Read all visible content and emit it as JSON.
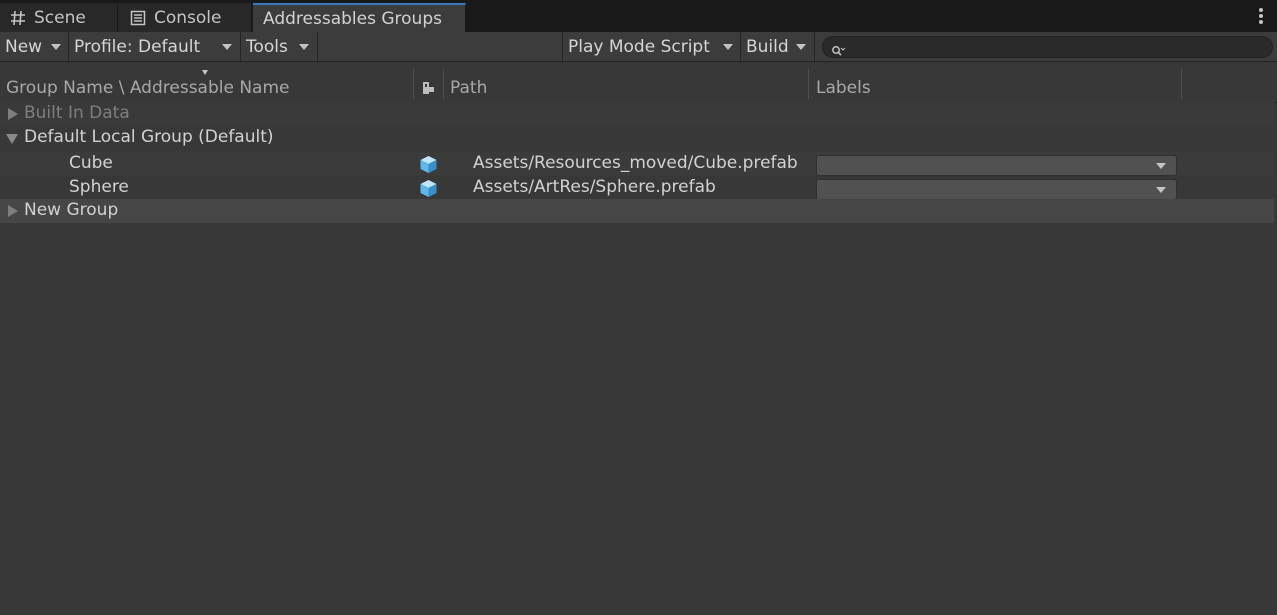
{
  "tabs": [
    {
      "label": "Scene",
      "icon": "grid-icon"
    },
    {
      "label": "Console",
      "icon": "console-icon"
    },
    {
      "label": "Addressables Groups",
      "active": true
    }
  ],
  "toolbar": {
    "new_label": "New",
    "profile_label": "Profile: Default",
    "tools_label": "Tools",
    "play_mode_label": "Play Mode Script",
    "build_label": "Build",
    "search_placeholder": ""
  },
  "columns": {
    "name": "Group Name \\ Addressable Name",
    "path": "Path",
    "labels": "Labels"
  },
  "groups": {
    "built_in": {
      "name": "Built In Data",
      "expanded": false
    },
    "default_local": {
      "name": "Default Local Group (Default)",
      "expanded": true,
      "entries": [
        {
          "name": "Cube",
          "path": "Assets/Resources_moved/Cube.prefab",
          "icon": "prefab-cube-icon",
          "labels": ""
        },
        {
          "name": "Sphere",
          "path": "Assets/ArtRes/Sphere.prefab",
          "icon": "prefab-cube-icon",
          "labels": ""
        }
      ]
    },
    "new_group": {
      "name": "New Group",
      "expanded": false
    }
  },
  "colors": {
    "background": "#383838",
    "tabbar": "#191919",
    "active_tab": "#3c3c3c",
    "accent": "#3a79bb",
    "prefab_icon": "#5fb7ea"
  }
}
